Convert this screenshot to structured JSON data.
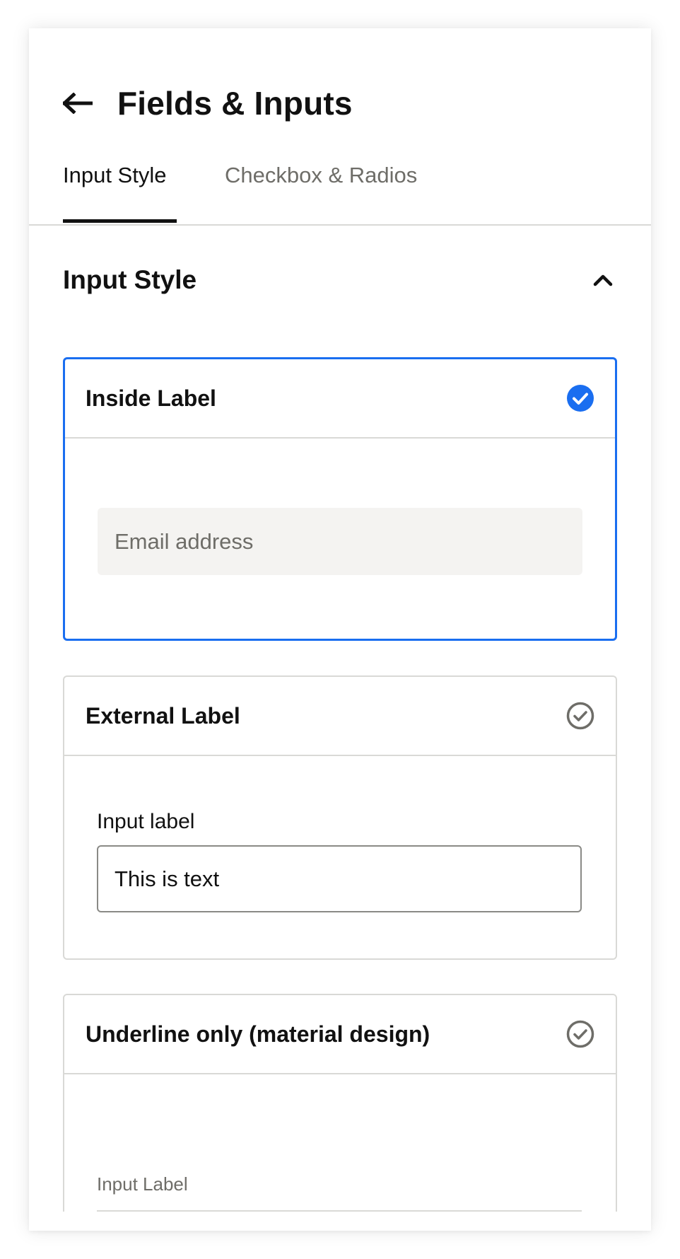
{
  "header": {
    "title": "Fields & Inputs"
  },
  "tabs": [
    {
      "label": "Input Style",
      "active": true
    },
    {
      "label": "Checkbox & Radios",
      "active": false
    }
  ],
  "section": {
    "title": "Input Style",
    "expanded": true
  },
  "options": [
    {
      "title": "Inside Label",
      "selected": true,
      "preview": {
        "placeholder": "Email address"
      }
    },
    {
      "title": "External Label",
      "selected": false,
      "preview": {
        "label": "Input label",
        "value": "This is text"
      }
    },
    {
      "title": "Underline only (material design)",
      "selected": false,
      "preview": {
        "label": "Input Label"
      }
    }
  ],
  "colors": {
    "accent": "#1a6ef0",
    "muted": "#6e6d68",
    "border": "#d9d9d6",
    "input_fill": "#f4f3f1"
  }
}
